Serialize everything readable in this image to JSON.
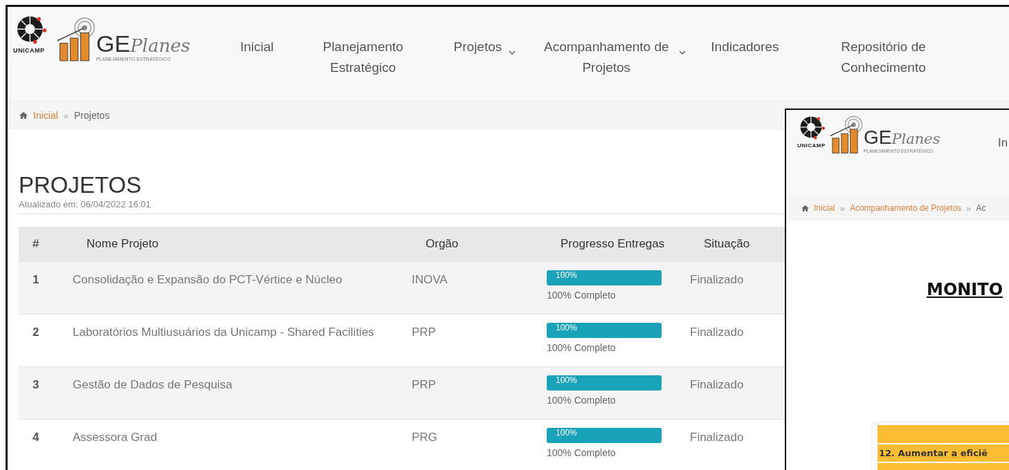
{
  "header": {
    "logo": {
      "university": "UNICAMP",
      "brand_prefix": "GE",
      "brand_suffix": "Planes",
      "tagline": "PLANEJAMENTO ESTRATÉGICO"
    },
    "nav": [
      {
        "label": "Inicial",
        "dropdown": false
      },
      {
        "label": "Planejamento Estratégico",
        "dropdown": false
      },
      {
        "label": "Projetos",
        "dropdown": true
      },
      {
        "label": "Acompanhamento de Projetos",
        "dropdown": true
      },
      {
        "label": "Indicadores",
        "dropdown": false
      },
      {
        "label": "Repositório de Conhecimento",
        "dropdown": false
      }
    ]
  },
  "breadcrumb": {
    "separator": "»",
    "items": [
      {
        "label": "Inicial",
        "link": true
      },
      {
        "label": "Projetos",
        "link": false
      }
    ]
  },
  "page": {
    "title": "PROJETOS",
    "updated": "Atualizado em: 06/04/2022 16:01"
  },
  "table": {
    "columns": [
      "#",
      "Nome Projeto",
      "Orgão",
      "Progresso Entregas",
      "Situação"
    ],
    "rows": [
      {
        "number": "1",
        "name": "Consolidação e Expansão do PCT-Vértice e Núcleo",
        "organ": "INOVA",
        "level": 1,
        "bar_label": "100%",
        "progress_text": "100% Completo",
        "status": "Finalizado"
      },
      {
        "number": "2",
        "name": "Laboratórios Multiusuários da Unicamp - Shared Facilities",
        "organ": "PRP",
        "level": 1,
        "bar_label": "100%",
        "progress_text": "100% Completo",
        "status": "Finalizado"
      },
      {
        "number": "3",
        "name": "Gestão de Dados de Pesquisa",
        "organ": "PRP",
        "level": 1,
        "bar_label": "100%",
        "progress_text": "100% Completo",
        "status": "Finalizado"
      },
      {
        "number": "4",
        "name": "Assessora Grad",
        "organ": "PRG",
        "level": 1,
        "bar_label": "100%",
        "progress_text": "100% Completo",
        "status": "Finalizado"
      }
    ]
  },
  "overlay": {
    "logo": {
      "university": "UNICAMP",
      "brand_prefix": "GE",
      "brand_suffix": "Planes",
      "tagline": "PLANEJAMENTO ESTRATÉGICO"
    },
    "nav": [
      {
        "label": "In"
      }
    ],
    "breadcrumb": {
      "separator": "»",
      "items": [
        {
          "label": "Inicial",
          "link": true
        },
        {
          "label": "Acompanhamento de Projetos",
          "link": true
        },
        {
          "label": "Ac",
          "link": false
        }
      ]
    },
    "heading": "MONITO",
    "table_rows": [
      "12. Aumentar a eficiê"
    ]
  }
}
